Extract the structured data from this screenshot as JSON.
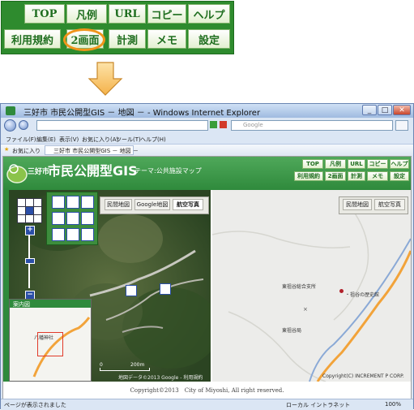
{
  "toolbar": {
    "row1": [
      "TOP",
      "凡例",
      "URL",
      "コピー",
      "ヘルプ"
    ],
    "row2": [
      "利用規約",
      "2画面",
      "計測",
      "メモ",
      "設定"
    ]
  },
  "browser": {
    "window_title": "三好市 市民公開型GIS － 地図 － - Windows Internet Explorer",
    "search_placeholder": "Google",
    "menu": [
      "ファイル(F)",
      "編集(E)",
      "表示(V)",
      "お気に入り(A)",
      "ツール(T)",
      "ヘルプ(H)"
    ],
    "favorites_label": "お気に入り",
    "tab_title": "三好市 市民公開型GIS － 地図 －",
    "status_text": "ページが表示されました",
    "zone_text": "ローカル イントラネット",
    "zoom_text": "100%"
  },
  "site": {
    "city": "三好市",
    "title": "市民公開型GIS",
    "theme": "テーマ:公共施設マップ",
    "header_row1": [
      "TOP",
      "凡例",
      "URL",
      "コピー",
      "ヘルプ"
    ],
    "header_row2": [
      "利用規約",
      "2画面",
      "計測",
      "メモ",
      "設定"
    ]
  },
  "map_left": {
    "buttons": [
      "民間地図",
      "Google地図",
      "航空写真"
    ],
    "overview_label": "案内図",
    "overview_place": "八幡神社",
    "scale_left": "0",
    "scale_right": "200m",
    "copyright": "地図データ©2013 Google - 利用規約"
  },
  "map_right": {
    "buttons": [
      "民間地図",
      "航空写真"
    ],
    "labels": [
      "東祖谷総合支所",
      "・祖谷の歴史館",
      "東祖谷局"
    ],
    "copyright": "Copyright(C) INCREMENT P CORP."
  },
  "footer": "Copyright©2013　City of Miyoshi, All right reserved.",
  "colors": {
    "header_green": "#2f8a3c",
    "highlight_ring": "#f0941a",
    "road_orange": "#f2a33a"
  }
}
